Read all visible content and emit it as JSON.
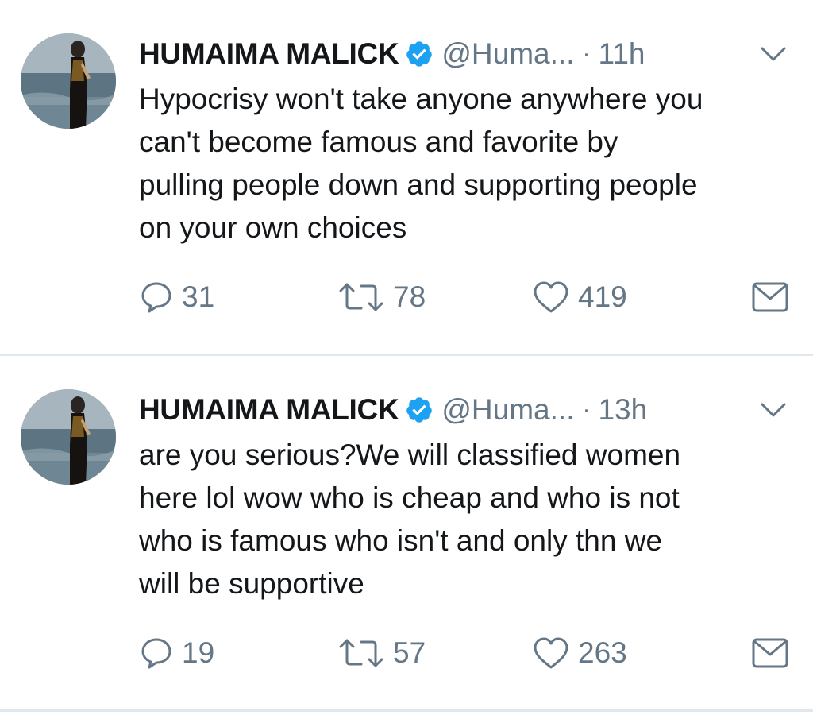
{
  "tweets": [
    {
      "author_name": "HUMAIMA MALICK",
      "handle": "@Huma...",
      "separator": "·",
      "time": "11h",
      "text": "Hypocrisy won't take anyone anywhere you\ncan't become famous and favorite by\npulling people down and supporting people\non your own choices",
      "replies": "31",
      "retweets": "78",
      "likes": "419"
    },
    {
      "author_name": "HUMAIMA MALICK",
      "handle": "@Huma...",
      "separator": "·",
      "time": "13h",
      "text": "are you serious?We will classified women\nhere lol wow who is cheap and who is not\nwho is famous who isn't and only thn we\nwill be supportive",
      "replies": "19",
      "retweets": "57",
      "likes": "263"
    }
  ],
  "colors": {
    "verified_badge": "#1da1f2",
    "secondary_text": "#657786",
    "primary_text": "#14171a",
    "divider": "#e1e8ed"
  },
  "icons": [
    "verified-badge-icon",
    "chevron-down-icon",
    "reply-icon",
    "retweet-icon",
    "heart-icon",
    "envelope-icon"
  ]
}
